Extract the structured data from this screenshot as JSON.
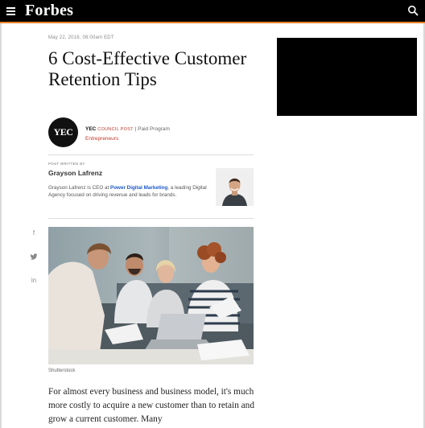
{
  "header": {
    "logo": "Forbes",
    "menu_icon": "hamburger-menu-icon",
    "search_icon": "search-icon",
    "accent_color": "#e8832a"
  },
  "article": {
    "date": "May 22, 2018, 08:00am EDT",
    "headline": "6 Cost-Effective Customer Retention Tips",
    "contributor": {
      "badge": "YEC",
      "name": "YEC",
      "council": "Council Post",
      "separator": " | ",
      "paid": "Paid Program",
      "category": "Entrepreneurs"
    },
    "post_written_by": "POST WRITTEN BY",
    "author_name": "Grayson Lafrenz",
    "bio_prefix": "Grayson Lafrenz is CEO at ",
    "bio_link": "Power Digital Marketing",
    "bio_suffix": ", a leading Digital Agency focused on driving revenue and leads for brands.",
    "image_credit": "Shutterstock",
    "body": "For almost every business and business model, it's much more costly to acquire a new customer than to retain and grow a current customer. Many"
  },
  "share": {
    "facebook": "f",
    "twitter": "twitter-icon",
    "linkedin": "in"
  }
}
